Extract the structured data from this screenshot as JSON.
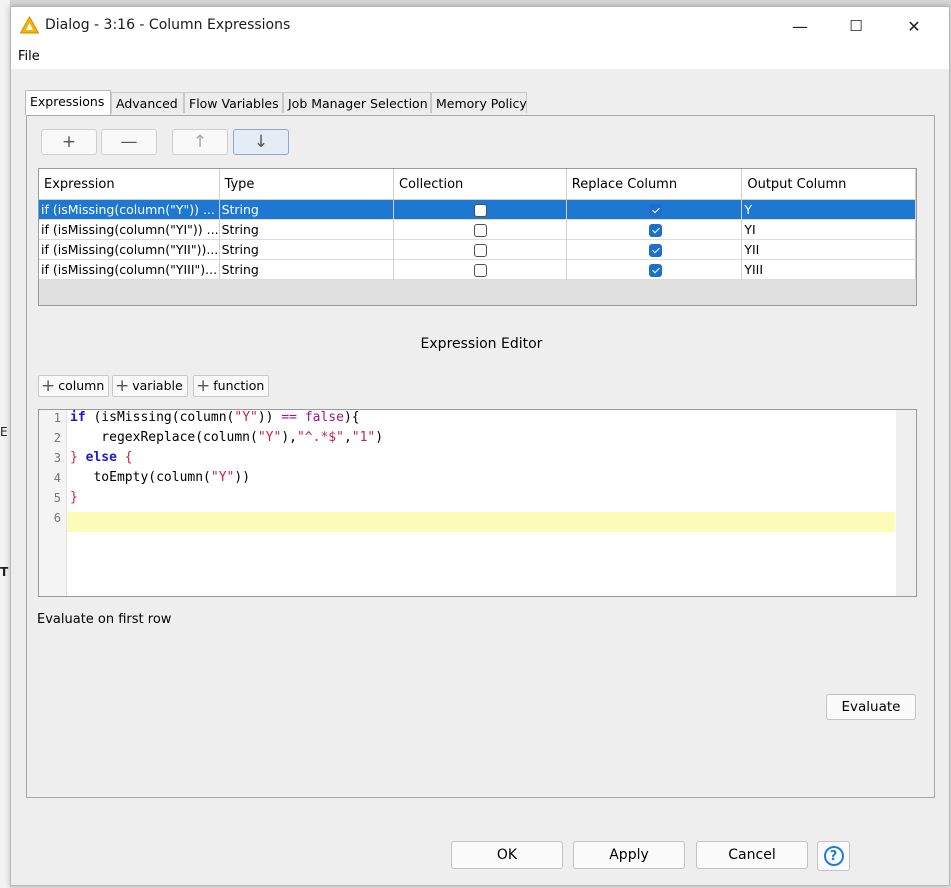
{
  "window": {
    "title": "Dialog - 3:16 - Column Expressions",
    "minimize_glyph": "—",
    "maximize_glyph": "☐",
    "close_glyph": "✕"
  },
  "menu": {
    "file": "File"
  },
  "background": {
    "left_chars": [
      "E",
      "T"
    ]
  },
  "tabs": [
    {
      "label": "Expressions",
      "active": true
    },
    {
      "label": "Advanced"
    },
    {
      "label": "Flow Variables"
    },
    {
      "label": "Job Manager Selection"
    },
    {
      "label": "Memory Policy"
    }
  ],
  "toolbar": {
    "add_glyph": "+",
    "remove_glyph": "—",
    "up_glyph": "↑",
    "down_glyph": "↓"
  },
  "table": {
    "columns": [
      "Expression",
      "Type",
      "Collection",
      "Replace Column",
      "Output Column"
    ],
    "rows": [
      {
        "expression": "if (isMissing(column(\"Y\")) ...",
        "type": "String",
        "collection": false,
        "replace": true,
        "output": "Y",
        "selected": true
      },
      {
        "expression": "if (isMissing(column(\"YI\")) ...",
        "type": "String",
        "collection": false,
        "replace": true,
        "output": "YI"
      },
      {
        "expression": "if (isMissing(column(\"YII\"))...",
        "type": "String",
        "collection": false,
        "replace": true,
        "output": "YII"
      },
      {
        "expression": "if (isMissing(column(\"YIII\")...",
        "type": "String",
        "collection": false,
        "replace": true,
        "output": "YIII"
      }
    ]
  },
  "expression_editor": {
    "title": "Expression Editor",
    "insert_buttons": {
      "column": "column",
      "variable": "variable",
      "function": "function"
    },
    "line_numbers": [
      "1",
      "2",
      "3",
      "4",
      "5",
      "6"
    ],
    "code": {
      "l1_if": "if",
      "l1_a": " (isMissing(column(",
      "l1_str": "\"Y\"",
      "l1_b": ")) ",
      "l1_op": "== false",
      "l1_c": "){",
      "l2_a": "    regexReplace(column(",
      "l2_s1": "\"Y\"",
      "l2_b": "),",
      "l2_s2": "\"^.*$\"",
      "l2_c": ",",
      "l2_s3": "\"1\"",
      "l2_d": ")",
      "l3_a": "} ",
      "l3_kw": "else",
      "l3_b": " {",
      "l4_a": "   toEmpty(column(",
      "l4_s": "\"Y\"",
      "l4_b": "))",
      "l5": "}"
    }
  },
  "evaluate": {
    "label": "Evaluate on first row",
    "button": "Evaluate"
  },
  "dialog_buttons": {
    "ok": "OK",
    "apply": "Apply",
    "cancel": "Cancel",
    "help": "?"
  }
}
